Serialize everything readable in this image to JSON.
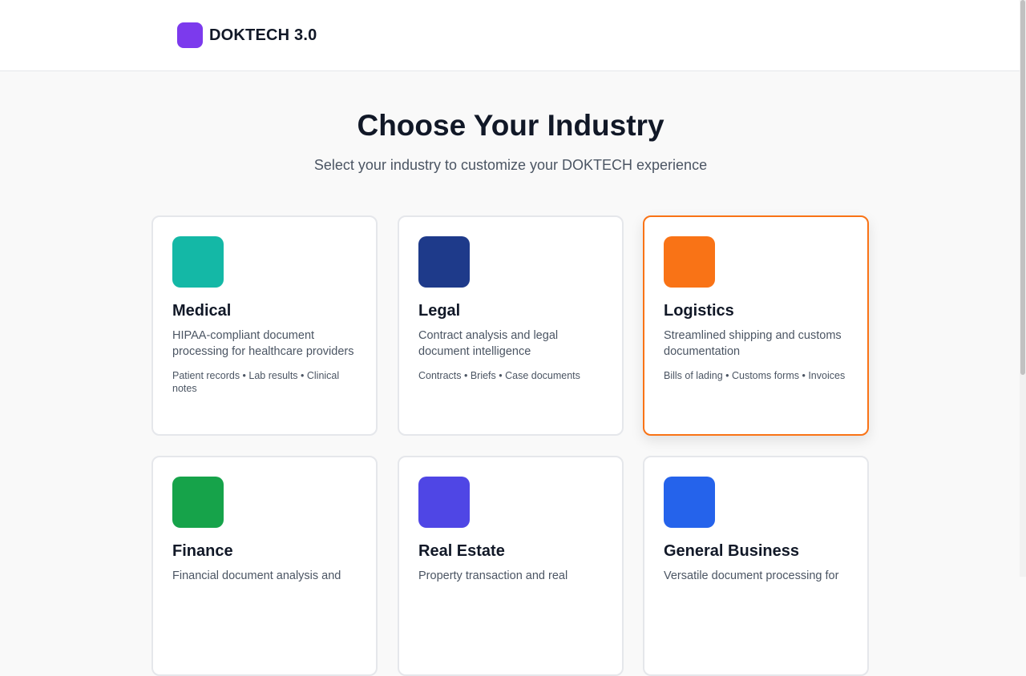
{
  "app": {
    "name": "DOKTECH 3.0",
    "brand_color": "#7c3aed"
  },
  "hero": {
    "title": "Choose Your Industry",
    "subtitle": "Select your industry to customize your DOKTECH experience"
  },
  "industries": [
    {
      "title": "Medical",
      "description": "HIPAA-compliant document processing for healthcare providers",
      "tags": "Patient records • Lab results • Clinical notes",
      "color": "#14b8a6",
      "selected": false
    },
    {
      "title": "Legal",
      "description": "Contract analysis and legal document intelligence",
      "tags": "Contracts • Briefs • Case documents",
      "color": "#1e3a8a",
      "selected": false
    },
    {
      "title": "Logistics",
      "description": "Streamlined shipping and customs documentation",
      "tags": "Bills of lading • Customs forms • Invoices",
      "color": "#f97316",
      "selected": true
    },
    {
      "title": "Finance",
      "description": "Financial document analysis and",
      "tags": "",
      "color": "#16a34a",
      "selected": false
    },
    {
      "title": "Real Estate",
      "description": "Property transaction and real",
      "tags": "",
      "color": "#4f46e5",
      "selected": false
    },
    {
      "title": "General Business",
      "description": "Versatile document processing for",
      "tags": "",
      "color": "#2563eb",
      "selected": false
    }
  ]
}
